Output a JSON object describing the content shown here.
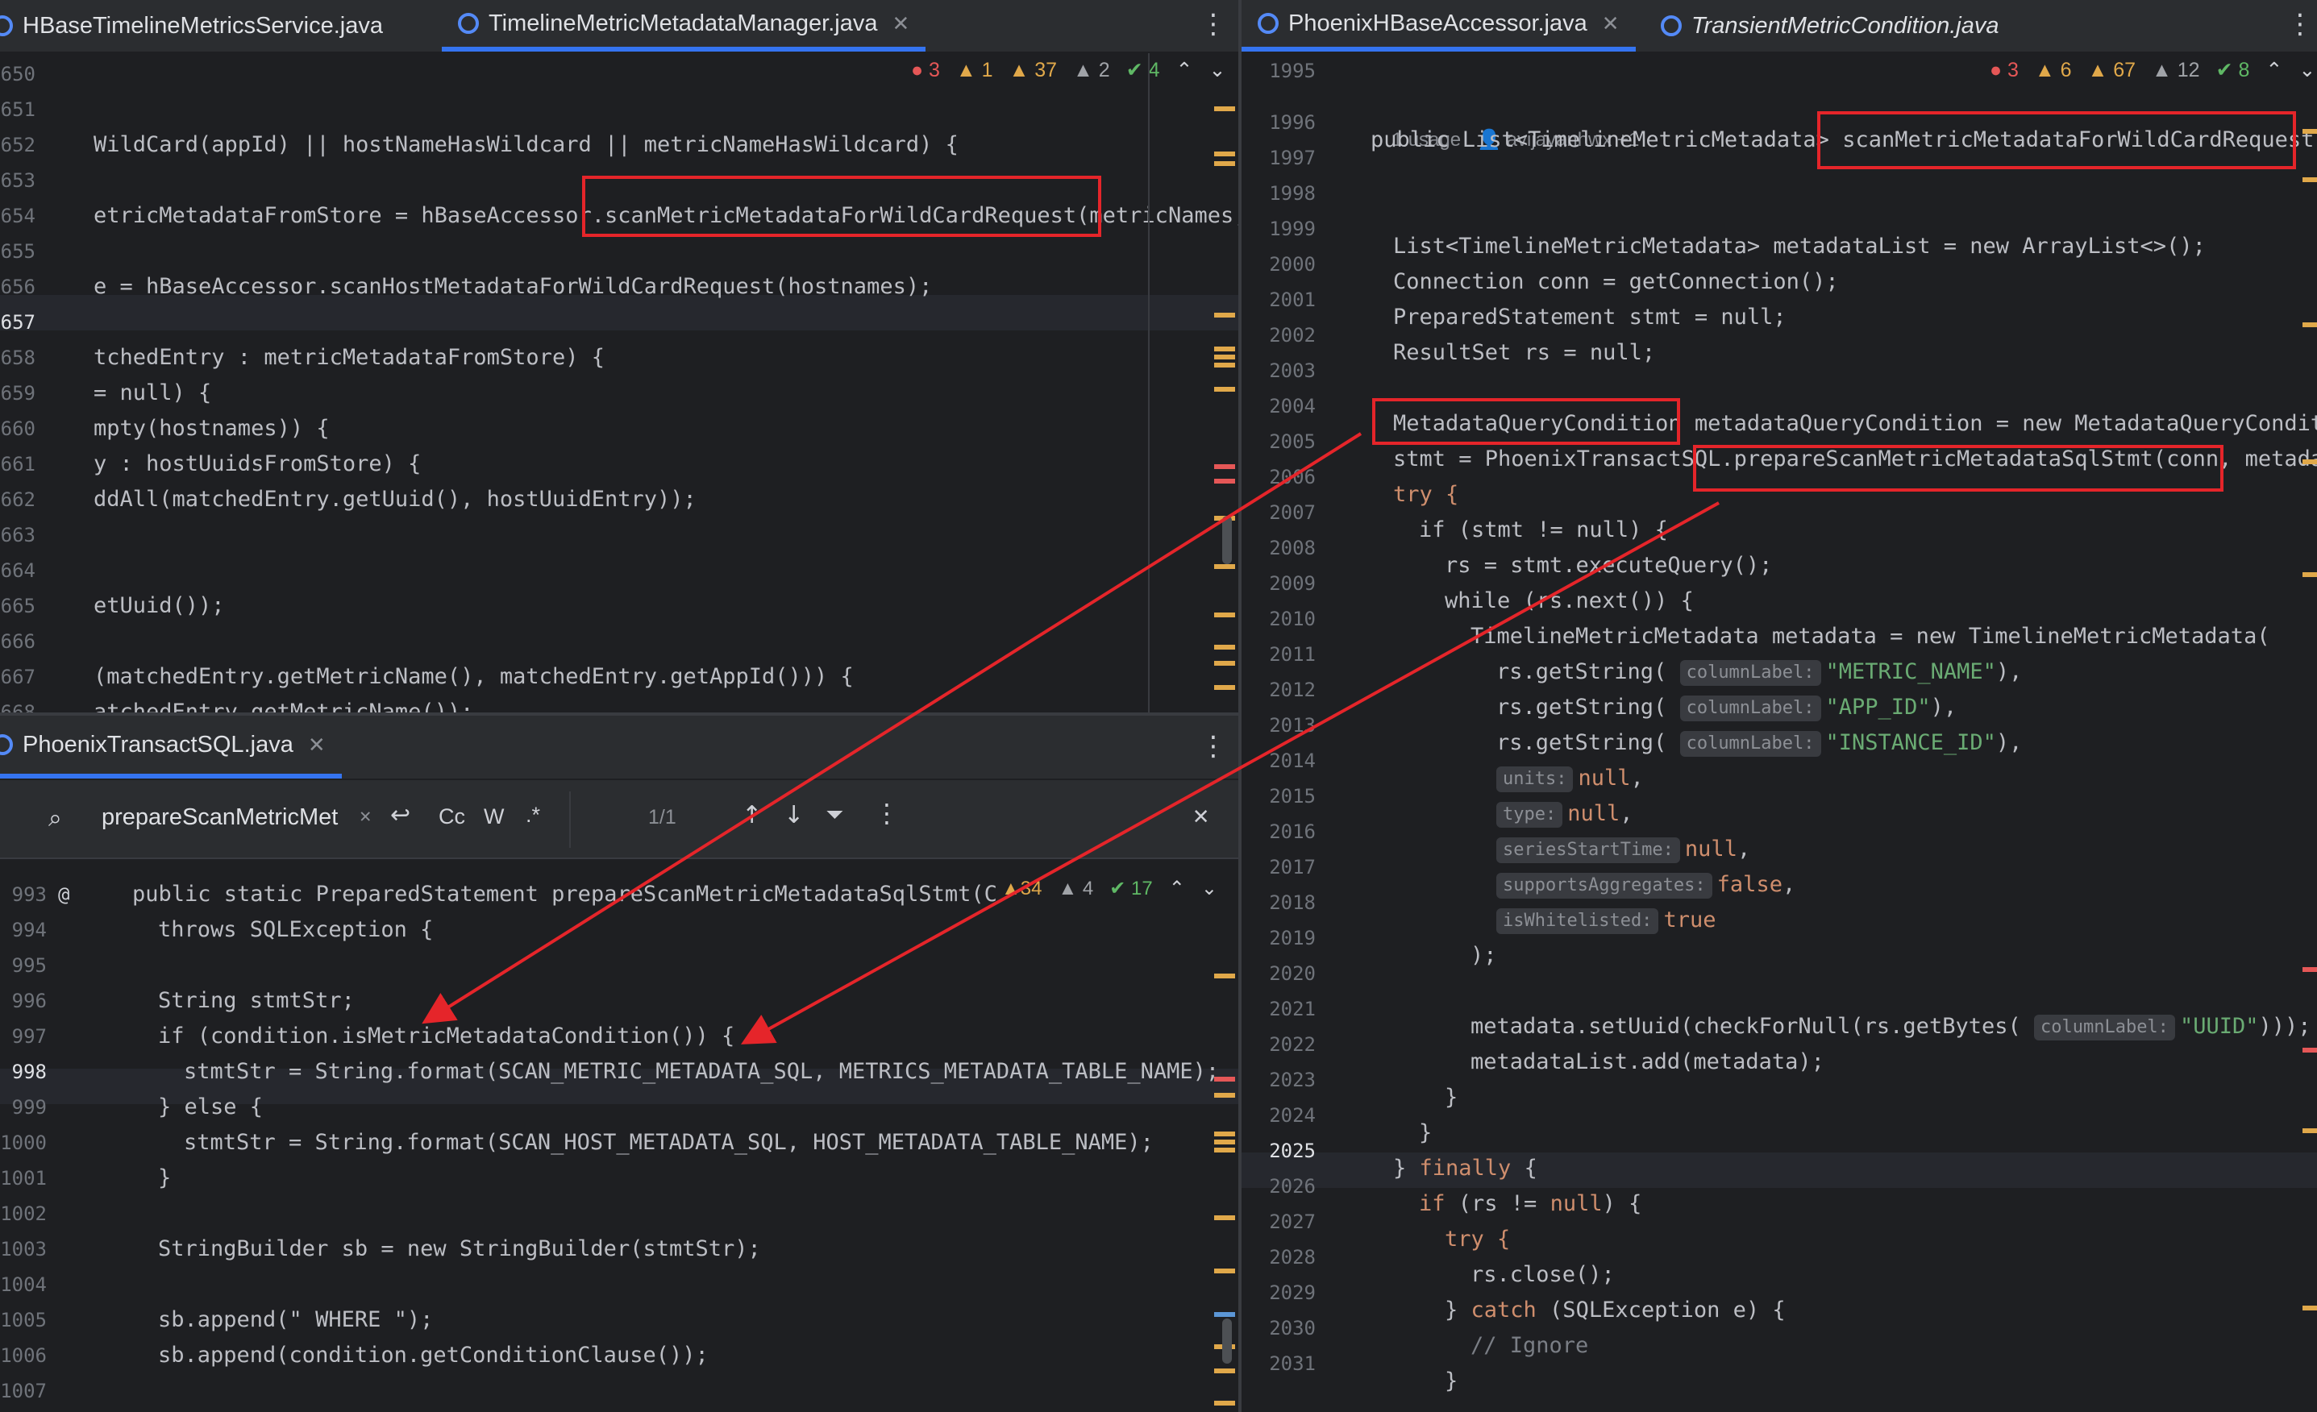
{
  "left_top": {
    "tabs": [
      {
        "label": "HBaseTimelineMetricsService.java",
        "active": false
      },
      {
        "label": "TimelineMetricMetadataManager.java",
        "active": true
      }
    ],
    "inspections": {
      "errors": "3",
      "warn1": "1",
      "warn2": "37",
      "weak": "2",
      "ok": "4"
    },
    "lines": [
      {
        "no": "650",
        "code": ""
      },
      {
        "no": "651",
        "code": ""
      },
      {
        "no": "652",
        "code": "WildCard(appId) || hostNameHasWildcard || metricNameHasWildcard) {"
      },
      {
        "no": "653",
        "code": ""
      },
      {
        "no": "654",
        "code": "etricMetadataFromStore = hBaseAccessor.scanMetricMetadataForWildCardRequest(metricNames,"
      },
      {
        "no": "655",
        "code": ""
      },
      {
        "no": "656",
        "code": "e = hBaseAccessor.scanHostMetadataForWildCardRequest(hostnames);"
      },
      {
        "no": "657",
        "code": ""
      },
      {
        "no": "658",
        "code": "tchedEntry : metricMetadataFromStore) {"
      },
      {
        "no": "659",
        "code": "= null) {"
      },
      {
        "no": "660",
        "code": "mpty(hostnames)) {"
      },
      {
        "no": "661",
        "code": "y : hostUuidsFromStore) {"
      },
      {
        "no": "662",
        "code": "ddAll(matchedEntry.getUuid(), hostUuidEntry));"
      },
      {
        "no": "663",
        "code": ""
      },
      {
        "no": "664",
        "code": ""
      },
      {
        "no": "665",
        "code": "etUuid());"
      },
      {
        "no": "666",
        "code": ""
      },
      {
        "no": "667",
        "code": "(matchedEntry.getMetricName(), matchedEntry.getAppId())) {"
      },
      {
        "no": "668",
        "code": "atchedEntry.getMetricName());"
      }
    ]
  },
  "left_bottom": {
    "tab": {
      "label": "PhoenixTransactSQL.java"
    },
    "find": {
      "query": "prepareScanMetricMet",
      "count": "1/1",
      "cc": "Cc",
      "w": "W",
      "regex": ".*"
    },
    "inspections": {
      "warn1": "34",
      "warn2": "4",
      "ok": "17"
    },
    "lines": [
      {
        "no": "993",
        "code": "public static PreparedStatement prepareScanMetricMetadataSqlStmt(C"
      },
      {
        "no": "994",
        "code": "throws SQLException {"
      },
      {
        "no": "995",
        "code": ""
      },
      {
        "no": "996",
        "code": "String stmtStr;"
      },
      {
        "no": "997",
        "code": "if (condition.isMetricMetadataCondition()) {"
      },
      {
        "no": "998",
        "code": "stmtStr = String.format(SCAN_METRIC_METADATA_SQL, METRICS_METADATA_TABLE_NAME);"
      },
      {
        "no": "999",
        "code": "} else {"
      },
      {
        "no": "1000",
        "code": "stmtStr = String.format(SCAN_HOST_METADATA_SQL, HOST_METADATA_TABLE_NAME);"
      },
      {
        "no": "1001",
        "code": "}"
      },
      {
        "no": "1002",
        "code": ""
      },
      {
        "no": "1003",
        "code": "StringBuilder sb = new StringBuilder(stmtStr);"
      },
      {
        "no": "1004",
        "code": ""
      },
      {
        "no": "1005",
        "code": "sb.append(\" WHERE \");"
      },
      {
        "no": "1006",
        "code": "sb.append(condition.getConditionClause());"
      },
      {
        "no": "1007",
        "code": ""
      }
    ]
  },
  "right": {
    "tabs": [
      {
        "label": "PhoenixHBaseAccessor.java",
        "active": true
      },
      {
        "label": "TransientMetricCondition.java",
        "active": false
      }
    ],
    "inspections": {
      "errors": "3",
      "warn1": "6",
      "warn2": "67",
      "weak": "12",
      "ok": "8"
    },
    "usage": "1 usage",
    "author": "avijayanhwx +1",
    "lines": [
      {
        "no": "1995"
      },
      {
        "no": "1996"
      },
      {
        "no": "1997"
      },
      {
        "no": "1998"
      },
      {
        "no": "1999"
      },
      {
        "no": "2000"
      },
      {
        "no": "2001"
      },
      {
        "no": "2002"
      },
      {
        "no": "2003"
      },
      {
        "no": "2004"
      },
      {
        "no": "2005"
      },
      {
        "no": "2006"
      },
      {
        "no": "2007"
      },
      {
        "no": "2008"
      },
      {
        "no": "2009"
      },
      {
        "no": "2010"
      },
      {
        "no": "2011"
      },
      {
        "no": "2012"
      },
      {
        "no": "2013"
      },
      {
        "no": "2014"
      },
      {
        "no": "2015"
      },
      {
        "no": "2016"
      },
      {
        "no": "2017"
      },
      {
        "no": "2018"
      },
      {
        "no": "2019"
      },
      {
        "no": "2020"
      },
      {
        "no": "2021"
      },
      {
        "no": "2022"
      },
      {
        "no": "2023"
      },
      {
        "no": "2024"
      },
      {
        "no": "2025"
      },
      {
        "no": "2026"
      },
      {
        "no": "2027"
      },
      {
        "no": "2028"
      },
      {
        "no": "2029"
      },
      {
        "no": "2030"
      },
      {
        "no": "2031"
      }
    ],
    "code": {
      "l1996": "public List<TimelineMetricMetadata> scanMetricMetadataForWildCardRequest(",
      "l1999": "List<TimelineMetricMetadata> metadataList = new ArrayList<>();",
      "l2000": "Connection conn = getConnection();",
      "l2001": "PreparedStatement stmt = null;",
      "l2002": "ResultSet rs = null;",
      "l2004": "MetadataQueryCondition metadataQueryCondition = new MetadataQueryConditi",
      "l2005": "stmt = PhoenixTransactSQL.prepareScanMetricMetadataSqlStmt(conn, metadat",
      "l2006": "try {",
      "l2007": "if (stmt != null) {",
      "l2008": "rs = stmt.executeQuery();",
      "l2009": "while (rs.next()) {",
      "l2010": "TimelineMetricMetadata metadata = new TimelineMetricMetadata(",
      "hint_col": "columnLabel:",
      "metric_name": "\"METRIC_NAME\"",
      "app_id": "\"APP_ID\"",
      "instance_id": "\"INSTANCE_ID\"",
      "hint_units": "units:",
      "hint_type": "type:",
      "hint_sst": "seriesStartTime:",
      "hint_sa": "supportsAggregates:",
      "hint_wl": "isWhitelisted:",
      "uuid": "\"UUID\"",
      "l2022": "metadataList.add(metadata);",
      "l2030": "// Ignore"
    }
  },
  "colors": {
    "accent": "#3574f0",
    "annotation_red": "#e5252a",
    "keyword": "#cf8e6d",
    "string": "#6aab73"
  }
}
